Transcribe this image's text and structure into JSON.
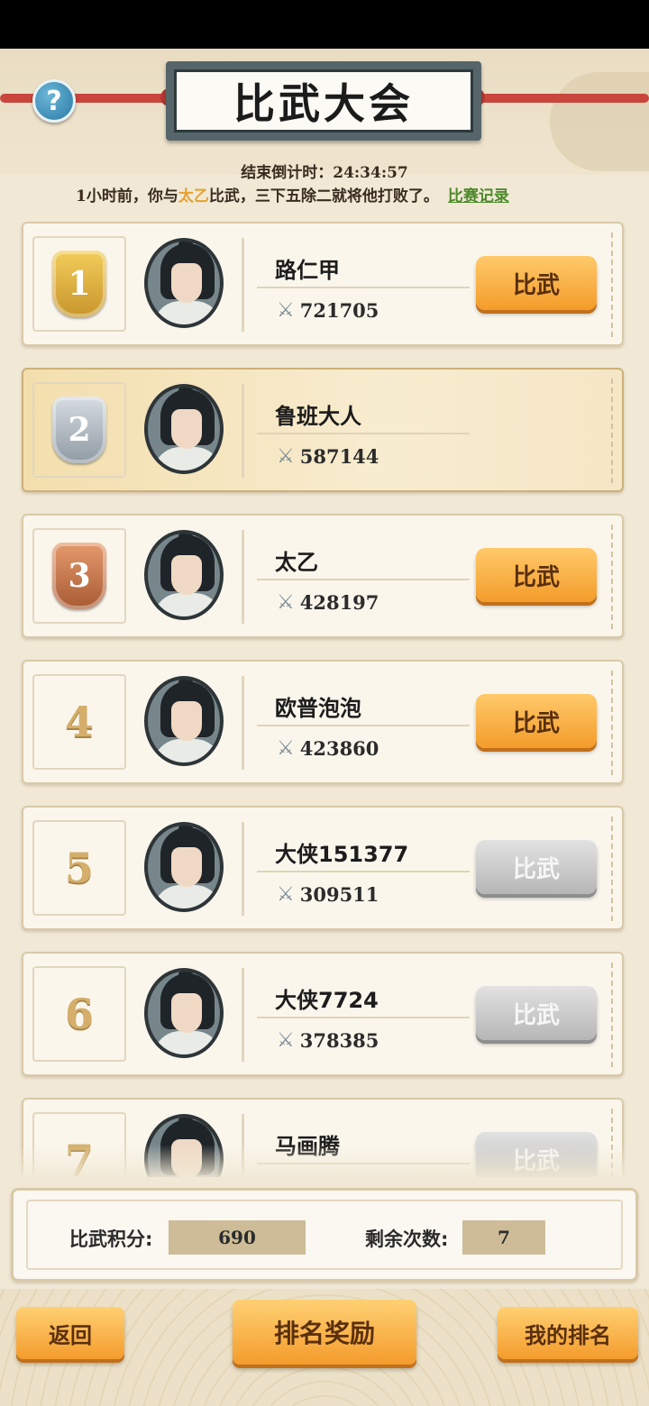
{
  "header": {
    "title": "比武大会",
    "help_icon": "question-mark-icon",
    "help_symbol": "?"
  },
  "countdown": {
    "label": "结束倒计时：",
    "value": "24:34:57"
  },
  "last_record": {
    "prefix": "1小时前，你与",
    "opponent": "太乙",
    "suffix": "比武，三下五除二就将他打败了。",
    "link": "比赛记录"
  },
  "ranking": [
    {
      "rank": "1",
      "name": "路仁甲",
      "power": "721705",
      "button": "比武",
      "button_state": "active",
      "medal": "gold"
    },
    {
      "rank": "2",
      "name": "鲁班大人",
      "power": "587144",
      "button": "",
      "button_state": "none",
      "medal": "silver",
      "is_self": true
    },
    {
      "rank": "3",
      "name": "太乙",
      "power": "428197",
      "button": "比武",
      "button_state": "active",
      "medal": "bronze"
    },
    {
      "rank": "4",
      "name": "欧普泡泡",
      "power": "423860",
      "button": "比武",
      "button_state": "active",
      "medal": "none"
    },
    {
      "rank": "5",
      "name": "大侠151377",
      "power": "309511",
      "button": "比武",
      "button_state": "disabled",
      "medal": "none"
    },
    {
      "rank": "6",
      "name": "大侠7724",
      "power": "378385",
      "button": "比武",
      "button_state": "disabled",
      "medal": "none"
    },
    {
      "rank": "7",
      "name": "马画腾",
      "power": "",
      "button": "比武",
      "button_state": "disabled",
      "medal": "none"
    }
  ],
  "stats": {
    "score_label": "比武积分:",
    "score_value": "690",
    "remaining_label": "剩余次数:",
    "remaining_value": "7"
  },
  "footer": {
    "back": "返回",
    "rewards": "排名奖励",
    "my_rank": "我的排名"
  },
  "colors": {
    "gold": "#e3b33c",
    "silver": "#a9b3bb",
    "bronze": "#c8744a",
    "button_active": "#f39c2a",
    "button_disabled": "#b6b6b6",
    "highlight_name": "#e6a12e",
    "link": "#4d8a2a"
  }
}
